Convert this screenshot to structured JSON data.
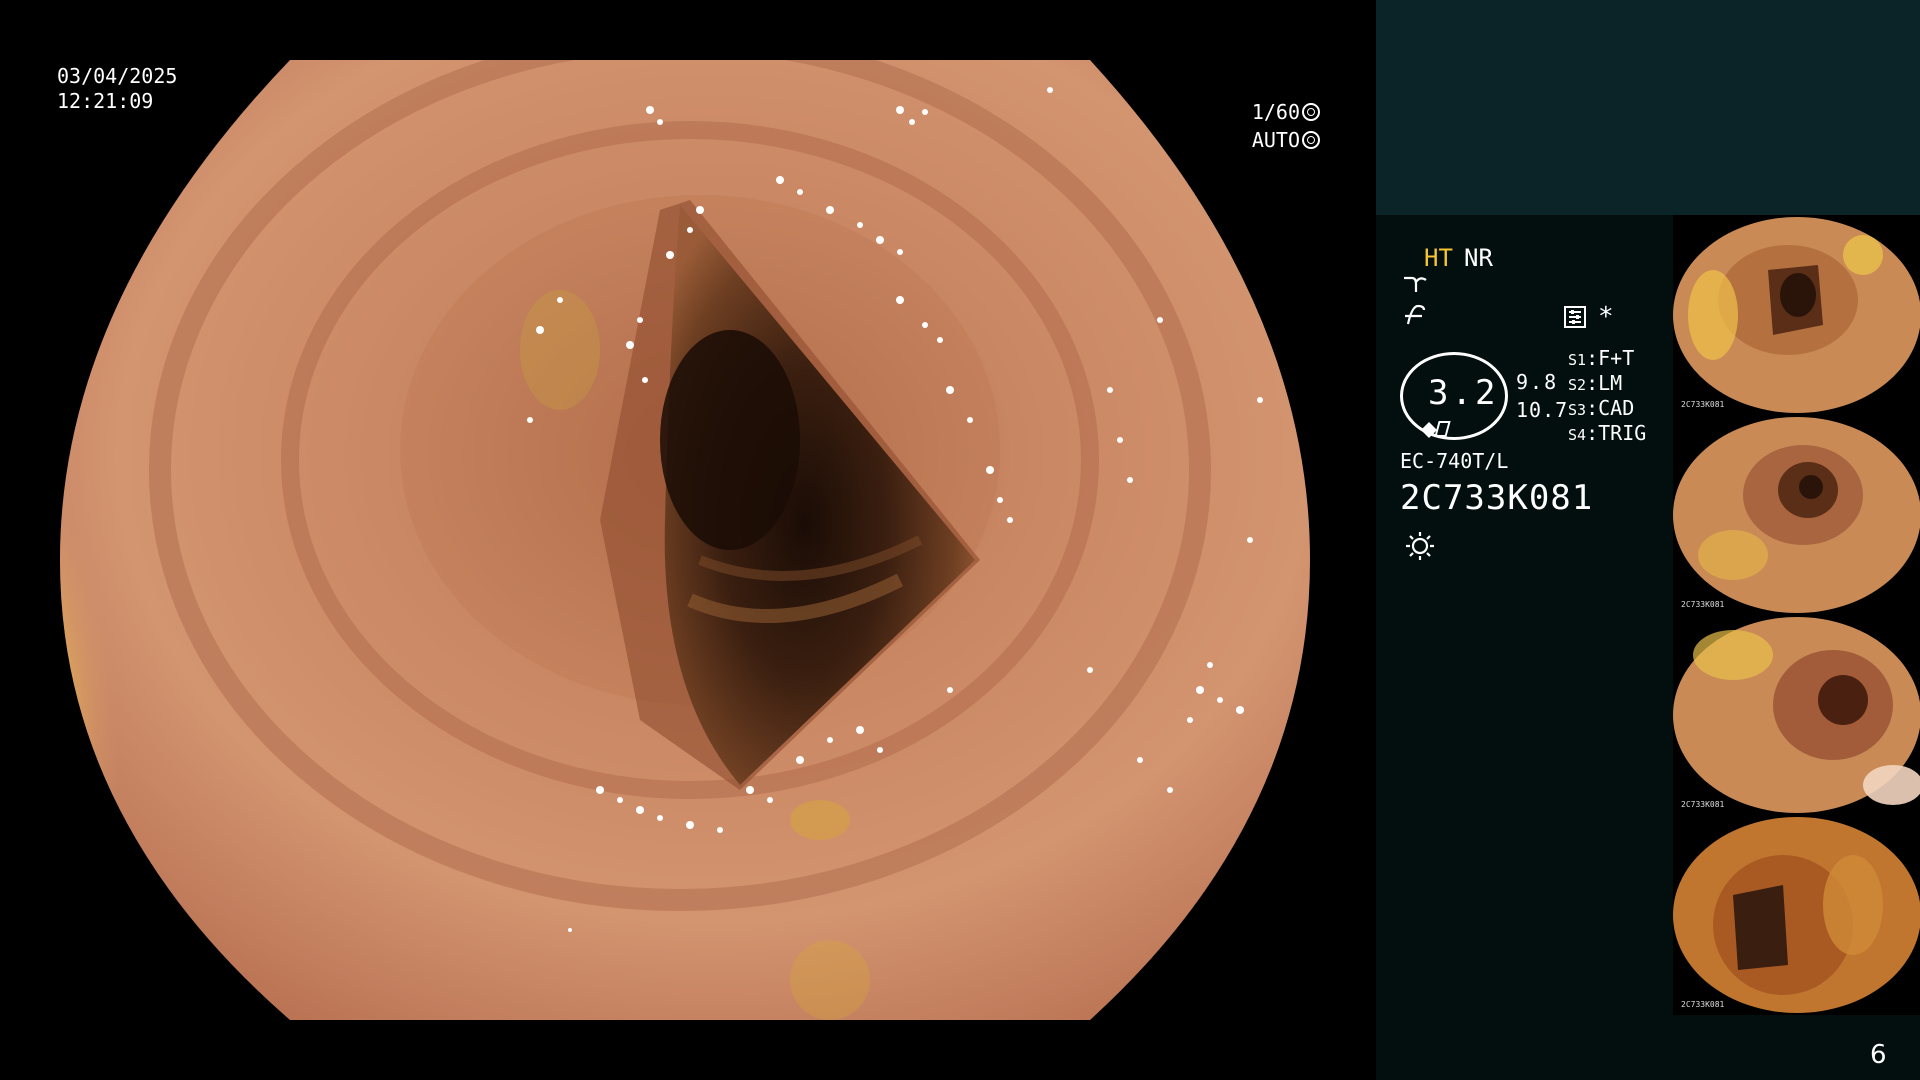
{
  "overlay": {
    "date": "03/04/2025",
    "time": "12:21:09",
    "shutter": "1/60",
    "exposure_mode": "AUTO"
  },
  "status": {
    "ht_label": "HT",
    "nr_label": "NR",
    "zoom_value": "3.2",
    "value_1": "9.8",
    "value_2": "10.7",
    "asterisk": "*",
    "switches": [
      {
        "key": "S1",
        "value": "F+T"
      },
      {
        "key": "S2",
        "value": "LM"
      },
      {
        "key": "S3",
        "value": "CAD"
      },
      {
        "key": "S4",
        "value": "TRIG"
      }
    ],
    "scope_model": "EC-740T/L",
    "serial_number": "2C733K081"
  },
  "thumbnails": [
    {
      "label": "2C733K081"
    },
    {
      "label": "2C733K081"
    },
    {
      "label": "2C733K081"
    },
    {
      "label": "2C733K081"
    }
  ],
  "page_number": "6",
  "colors": {
    "accent_ht": "#f7c531",
    "panel_bg": "#030f0e",
    "top_panel_bg": "#0b2428"
  }
}
